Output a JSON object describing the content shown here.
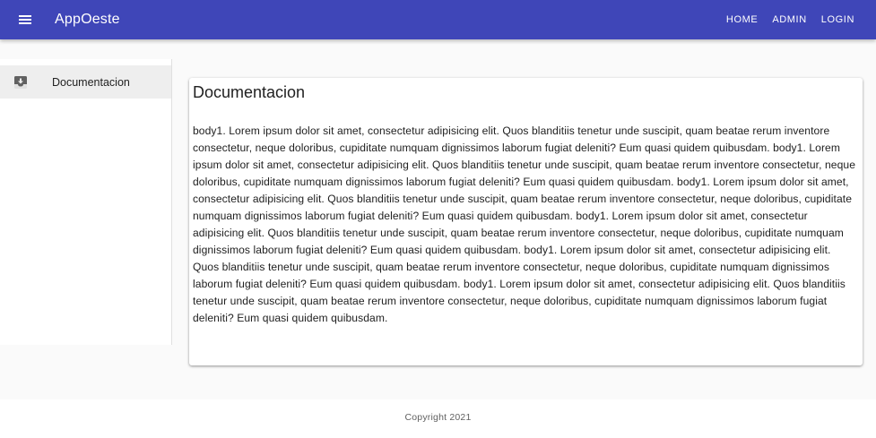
{
  "appbar": {
    "menu_icon": "menu-icon",
    "title": "AppOeste",
    "nav": [
      "HOME",
      "ADMIN",
      "LOGIN"
    ]
  },
  "sidebar": {
    "items": [
      {
        "label": "Documentacion",
        "icon": "inbox-download-icon"
      }
    ]
  },
  "main": {
    "title": "Documentacion",
    "body": "body1. Lorem ipsum dolor sit amet, consectetur adipisicing elit. Quos blanditiis tenetur unde suscipit, quam beatae rerum inventore consectetur, neque doloribus, cupiditate numquam dignissimos laborum fugiat deleniti? Eum quasi quidem quibusdam. body1. Lorem ipsum dolor sit amet, consectetur adipisicing elit. Quos blanditiis tenetur unde suscipit, quam beatae rerum inventore consectetur, neque doloribus, cupiditate numquam dignissimos laborum fugiat deleniti? Eum quasi quidem quibusdam. body1. Lorem ipsum dolor sit amet, consectetur adipisicing elit. Quos blanditiis tenetur unde suscipit, quam beatae rerum inventore consectetur, neque doloribus, cupiditate numquam dignissimos laborum fugiat deleniti? Eum quasi quidem quibusdam. body1. Lorem ipsum dolor sit amet, consectetur adipisicing elit. Quos blanditiis tenetur unde suscipit, quam beatae rerum inventore consectetur, neque doloribus, cupiditate numquam dignissimos laborum fugiat deleniti? Eum quasi quidem quibusdam. body1. Lorem ipsum dolor sit amet, consectetur adipisicing elit. Quos blanditiis tenetur unde suscipit, quam beatae rerum inventore consectetur, neque doloribus, cupiditate numquam dignissimos laborum fugiat deleniti? Eum quasi quidem quibusdam. body1. Lorem ipsum dolor sit amet, consectetur adipisicing elit. Quos blanditiis tenetur unde suscipit, quam beatae rerum inventore consectetur, neque doloribus, cupiditate numquam dignissimos laborum fugiat deleniti? Eum quasi quidem quibusdam."
  },
  "footer": {
    "text": "Copyright 2021"
  },
  "colors": {
    "primary": "#3f46b8",
    "background": "#fafafa",
    "selected_item": "#eeeeee"
  }
}
